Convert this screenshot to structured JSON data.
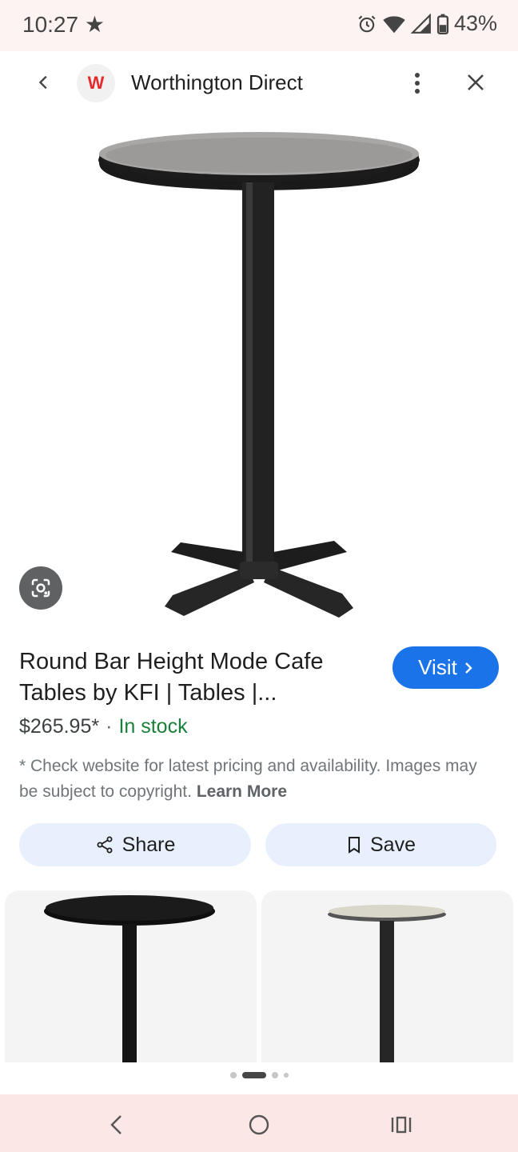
{
  "status_bar": {
    "time": "10:27",
    "battery": "43%",
    "icons": [
      "star-icon",
      "alarm-icon",
      "wifi-icon",
      "signal-icon",
      "battery-icon"
    ]
  },
  "top_bar": {
    "logo_letter": "W",
    "site_name": "Worthington Direct",
    "icons": [
      "back-arrow-icon",
      "more-vert-icon",
      "close-icon"
    ]
  },
  "product": {
    "title": "Round Bar Height Mode Cafe Tables by KFI | Tables |...",
    "visit_label": "Visit",
    "price": "$265.95*",
    "separator": "·",
    "stock": "In stock",
    "disclaimer": "* Check website for latest pricing and availability. Images may be subject to copyright.",
    "learn_more": "Learn More"
  },
  "actions": {
    "share_label": "Share",
    "save_label": "Save"
  },
  "colors": {
    "accent": "#1a73e8",
    "in_stock": "#188038",
    "action_bg": "#e8f0fe",
    "status_bg": "#fdf3f2",
    "nav_bg": "#fbe7e5",
    "logo": "#e52b2b"
  },
  "carousel": {
    "page_count": 4,
    "active_index": 1
  }
}
